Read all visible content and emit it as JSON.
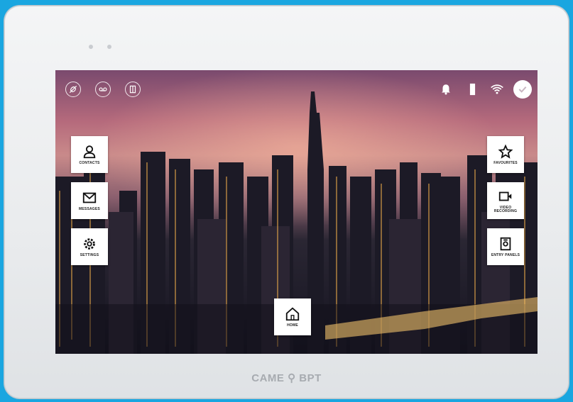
{
  "device": {
    "brand": "CAME ⚲ BPT"
  },
  "top_bar": {
    "left_icons": [
      "mute-icon",
      "voicemail-icon",
      "door-icon"
    ],
    "right_icons": [
      "bell-icon",
      "battery-icon",
      "wifi-icon",
      "check-icon"
    ]
  },
  "tiles": {
    "contacts": "CONTACTS",
    "messages": "MESSAGES",
    "settings": "SETTINGS",
    "favourites": "FAVOURITES",
    "video_recording": "VIDEO RECORDING",
    "entry_panels": "ENTRY PANELS",
    "home": "HOME"
  }
}
